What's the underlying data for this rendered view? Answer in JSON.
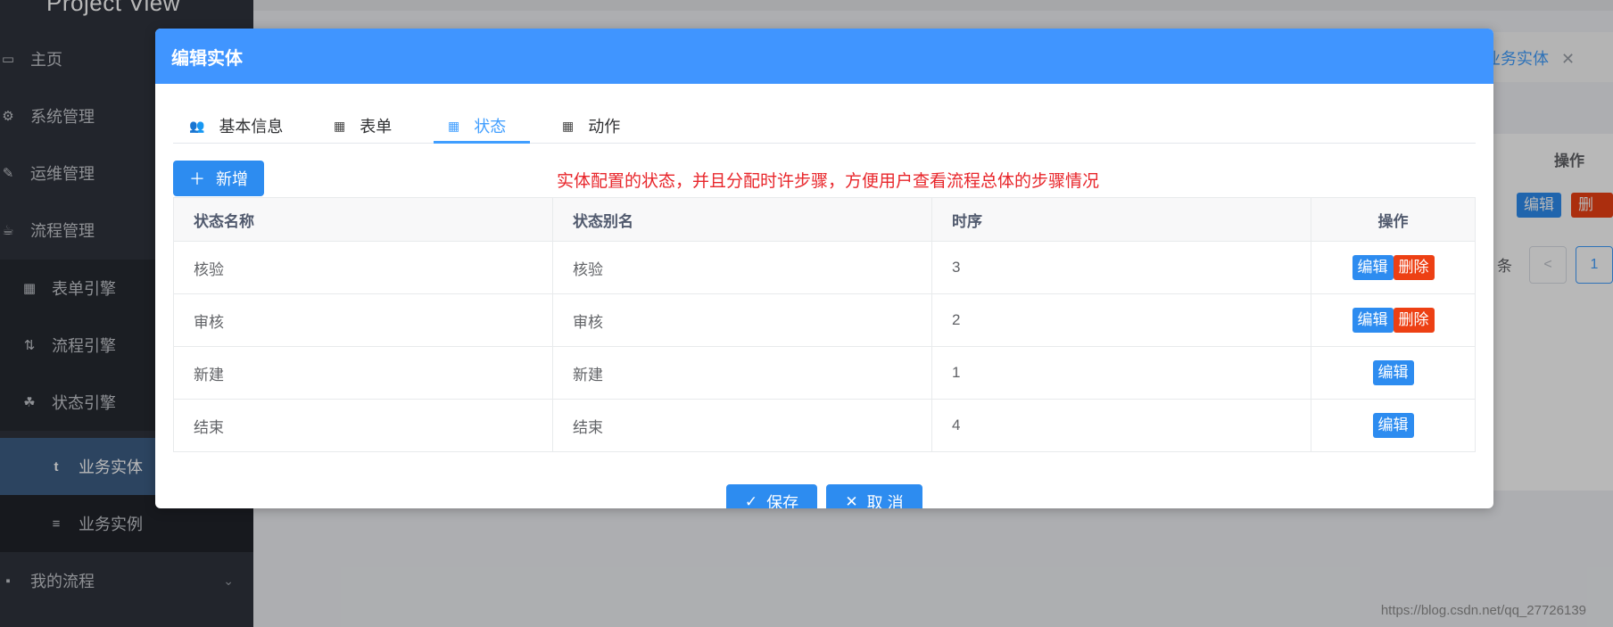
{
  "app": {
    "title": "Project View"
  },
  "sidebar": {
    "items": [
      {
        "label": "主页",
        "icon": "monitor-icon"
      },
      {
        "label": "系统管理",
        "icon": "gear-icon"
      },
      {
        "label": "运维管理",
        "icon": "wrench-icon"
      },
      {
        "label": "流程管理",
        "icon": "coffee-icon"
      },
      {
        "label": "表单引擎",
        "icon": "grid-icon"
      },
      {
        "label": "流程引擎",
        "icon": "flow-icon"
      },
      {
        "label": "状态引擎",
        "icon": "cubes-icon"
      },
      {
        "label": "业务实体",
        "icon": "tumblr-icon"
      },
      {
        "label": "业务实例",
        "icon": "list-icon"
      },
      {
        "label": "我的流程",
        "icon": "briefcase-icon"
      }
    ]
  },
  "background": {
    "tab_label": "业务实体",
    "header_op": "操作",
    "edit": "编辑",
    "delete": "删除",
    "pager_text": "条",
    "page_prev": "<",
    "page_num": "1"
  },
  "dialog": {
    "title": "编辑实体",
    "tabs": [
      {
        "label": "基本信息",
        "icon": "users-icon"
      },
      {
        "label": "表单",
        "icon": "grid-icon"
      },
      {
        "label": "状态",
        "icon": "grid-icon"
      },
      {
        "label": "动作",
        "icon": "grid-icon"
      }
    ],
    "active_tab": "状态",
    "add_button": "新增",
    "annotation": "实体配置的状态，并且分配时许步骤，方便用户查看流程总体的步骤情况",
    "table": {
      "columns": [
        "状态名称",
        "状态别名",
        "时序",
        "操作"
      ],
      "rows": [
        {
          "name": "核验",
          "alias": "核验",
          "order": "3",
          "actions": [
            "编辑",
            "删除"
          ]
        },
        {
          "name": "审核",
          "alias": "审核",
          "order": "2",
          "actions": [
            "编辑",
            "删除"
          ]
        },
        {
          "name": "新建",
          "alias": "新建",
          "order": "1",
          "actions": [
            "编辑"
          ]
        },
        {
          "name": "结束",
          "alias": "结束",
          "order": "4",
          "actions": [
            "编辑"
          ]
        }
      ]
    },
    "save_button": "保存",
    "cancel_button": "取 消"
  },
  "watermark": "https://blog.csdn.net/qq_27726139",
  "colors": {
    "primary": "#2d8cf0",
    "header": "#4095ff",
    "danger": "#ed4014",
    "annotation": "#e8262b",
    "sidebar": "#30343d"
  }
}
